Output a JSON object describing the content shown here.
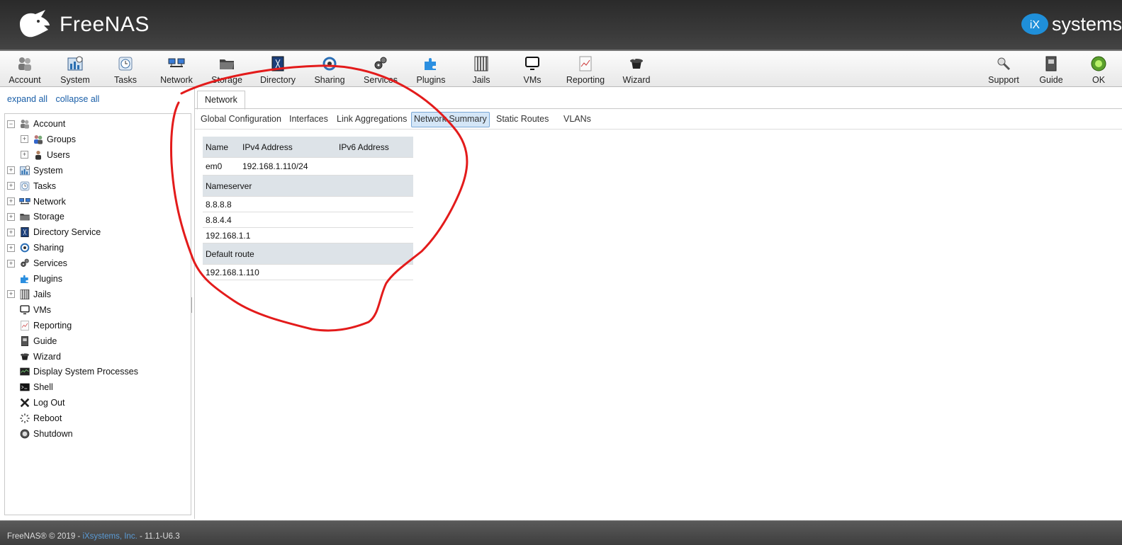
{
  "header": {
    "logo_text": "FreeNAS",
    "vendor_logo_badge": "iX",
    "vendor_logo_text": "systems"
  },
  "toolbar": {
    "items": [
      {
        "label": "Account",
        "icon": "users-icon"
      },
      {
        "label": "System",
        "icon": "system-chart-icon"
      },
      {
        "label": "Tasks",
        "icon": "clock-icon"
      },
      {
        "label": "Network",
        "icon": "network-icon"
      },
      {
        "label": "Storage",
        "icon": "folder-icon"
      },
      {
        "label": "Directory",
        "icon": "directory-icon"
      },
      {
        "label": "Sharing",
        "icon": "sharing-icon"
      },
      {
        "label": "Services",
        "icon": "gears-icon"
      },
      {
        "label": "Plugins",
        "icon": "puzzle-icon"
      },
      {
        "label": "Jails",
        "icon": "jail-bars-icon"
      },
      {
        "label": "VMs",
        "icon": "monitor-icon"
      },
      {
        "label": "Reporting",
        "icon": "report-icon"
      },
      {
        "label": "Wizard",
        "icon": "wizard-hat-icon"
      }
    ],
    "right_items": [
      {
        "label": "Support",
        "icon": "support-icon"
      },
      {
        "label": "Guide",
        "icon": "guide-icon"
      },
      {
        "label": "OK",
        "icon": "status-ok-icon"
      }
    ]
  },
  "sidebar": {
    "expand_all": "expand all",
    "collapse_all": "collapse all",
    "tree": [
      {
        "label": "Account",
        "expander": "−",
        "icon": "users-icon"
      },
      {
        "label": "Groups",
        "expander": "+",
        "icon": "group-icon",
        "indent": 1
      },
      {
        "label": "Users",
        "expander": "+",
        "icon": "user-icon",
        "indent": 1
      },
      {
        "label": "System",
        "expander": "+",
        "icon": "system-chart-icon"
      },
      {
        "label": "Tasks",
        "expander": "+",
        "icon": "clock-icon"
      },
      {
        "label": "Network",
        "expander": "+",
        "icon": "network-icon"
      },
      {
        "label": "Storage",
        "expander": "+",
        "icon": "folder-icon"
      },
      {
        "label": "Directory Service",
        "expander": "+",
        "icon": "directory-icon"
      },
      {
        "label": "Sharing",
        "expander": "+",
        "icon": "sharing-icon"
      },
      {
        "label": "Services",
        "expander": "+",
        "icon": "gears-icon"
      },
      {
        "label": "Plugins",
        "expander": "",
        "icon": "puzzle-icon"
      },
      {
        "label": "Jails",
        "expander": "+",
        "icon": "jail-bars-icon"
      },
      {
        "label": "VMs",
        "expander": "",
        "icon": "monitor-icon"
      },
      {
        "label": "Reporting",
        "expander": "",
        "icon": "report-icon"
      },
      {
        "label": "Guide",
        "expander": "",
        "icon": "guide-icon"
      },
      {
        "label": "Wizard",
        "expander": "",
        "icon": "wizard-hat-icon"
      },
      {
        "label": "Display System Processes",
        "expander": "",
        "icon": "processes-icon"
      },
      {
        "label": "Shell",
        "expander": "",
        "icon": "shell-icon"
      },
      {
        "label": "Log Out",
        "expander": "",
        "icon": "logout-x-icon"
      },
      {
        "label": "Reboot",
        "expander": "",
        "icon": "reboot-spinner-icon"
      },
      {
        "label": "Shutdown",
        "expander": "",
        "icon": "power-icon"
      }
    ]
  },
  "main": {
    "outer_tab": "Network",
    "subtabs": [
      {
        "label": "Global Configuration",
        "active": false
      },
      {
        "label": "Interfaces",
        "active": false
      },
      {
        "label": "Link Aggregations",
        "active": false
      },
      {
        "label": "Network Summary",
        "active": true
      },
      {
        "label": "Static Routes",
        "active": false
      },
      {
        "label": "VLANs",
        "active": false
      }
    ],
    "summary": {
      "interface_headers": [
        "Name",
        "IPv4 Address",
        "IPv6 Address"
      ],
      "interfaces": [
        {
          "name": "em0",
          "ipv4": "192.168.1.110/24",
          "ipv6": ""
        }
      ],
      "nameserver_header": "Nameserver",
      "nameservers": [
        "8.8.8.8",
        "8.8.4.4",
        "192.168.1.1"
      ],
      "default_route_header": "Default route",
      "default_route": "192.168.1.110"
    }
  },
  "footer": {
    "prefix": "FreeNAS® © 2019 - ",
    "company_link": "iXsystems, Inc.",
    "version": " - 11.1-U6.3"
  },
  "colors": {
    "annotation": "#e31b1b",
    "link": "#1a5fa8",
    "active_tab": "#d4e6f7",
    "table_header": "#dde3e8"
  }
}
